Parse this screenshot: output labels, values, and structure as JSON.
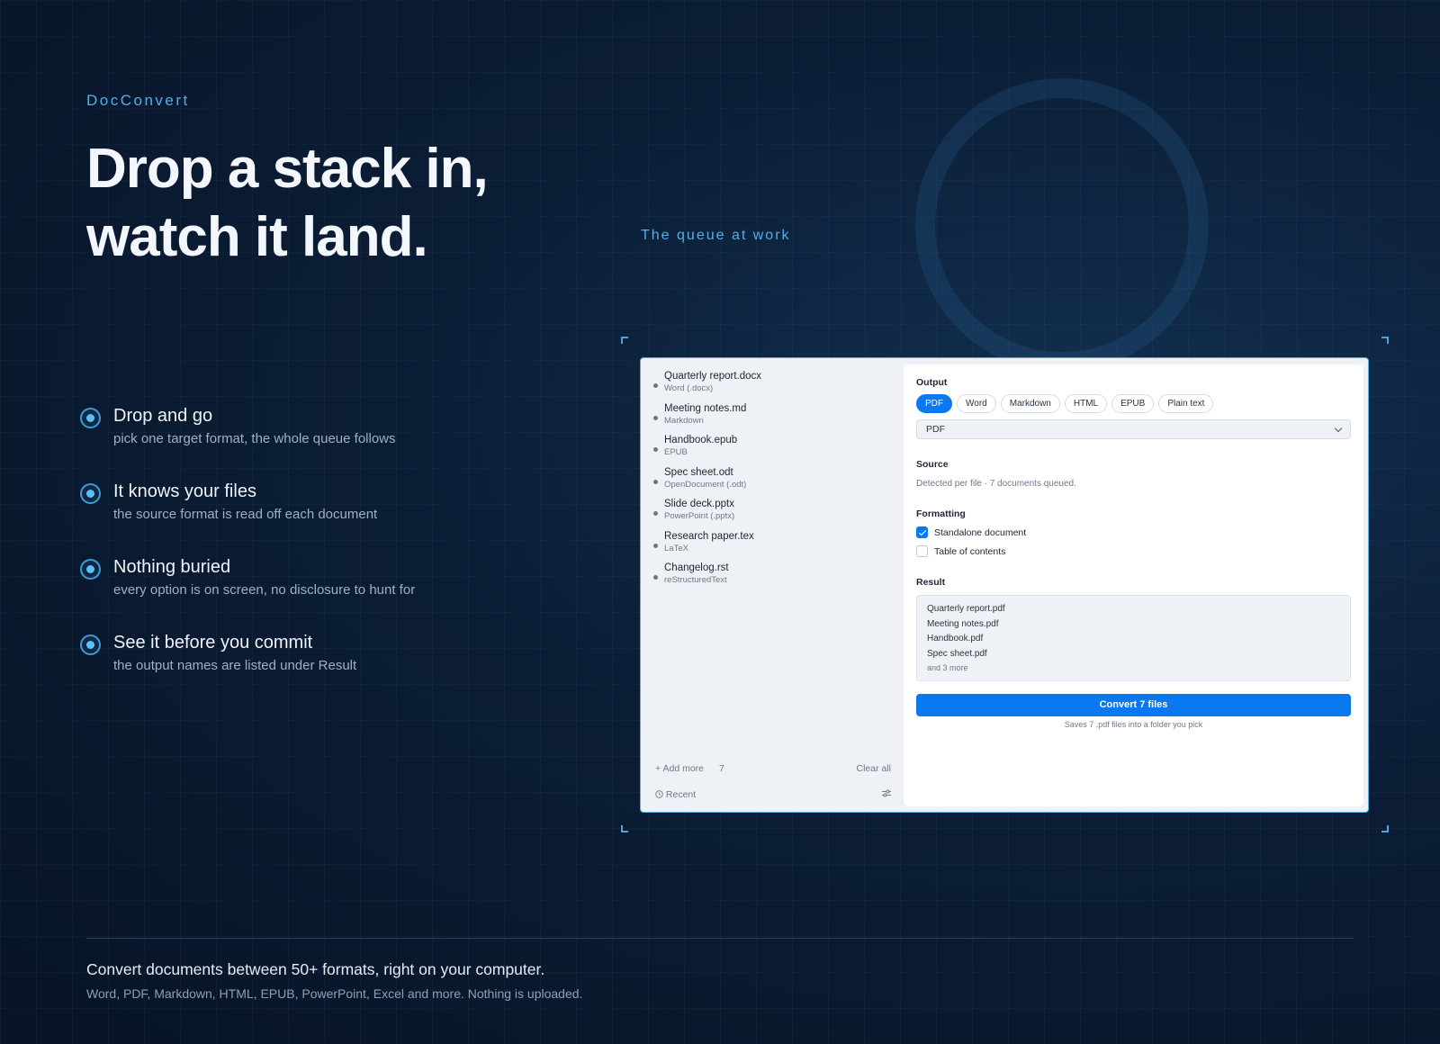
{
  "brand": "DocConvert",
  "headline": [
    "Drop a stack in,",
    "watch it land."
  ],
  "queue_label": "The queue at work",
  "features": [
    {
      "title": "Drop and go",
      "desc": "pick one target format, the whole queue follows"
    },
    {
      "title": "It knows your files",
      "desc": "the source format is read off each document"
    },
    {
      "title": "Nothing buried",
      "desc": "every option is on screen, no disclosure to hunt for"
    },
    {
      "title": "See it before you commit",
      "desc": "the output names are listed under Result"
    }
  ],
  "app": {
    "files": [
      {
        "name": "Quarterly report.docx",
        "format": "Word (.docx)"
      },
      {
        "name": "Meeting notes.md",
        "format": "Markdown"
      },
      {
        "name": "Handbook.epub",
        "format": "EPUB"
      },
      {
        "name": "Spec sheet.odt",
        "format": "OpenDocument (.odt)"
      },
      {
        "name": "Slide deck.pptx",
        "format": "PowerPoint (.pptx)"
      },
      {
        "name": "Research paper.tex",
        "format": "LaTeX"
      },
      {
        "name": "Changelog.rst",
        "format": "reStructuredText"
      }
    ],
    "sidebar_footer": {
      "add_more": "Add more",
      "count": "7",
      "clear_all": "Clear all",
      "recent": "Recent"
    },
    "output": {
      "title": "Output",
      "chips": [
        "PDF",
        "Word",
        "Markdown",
        "HTML",
        "EPUB",
        "Plain text"
      ],
      "active_chip": "PDF",
      "select_value": "PDF"
    },
    "source": {
      "title": "Source",
      "text": "Detected per file · 7 documents queued."
    },
    "formatting": {
      "title": "Formatting",
      "options": [
        {
          "label": "Standalone document",
          "checked": true
        },
        {
          "label": "Table of contents",
          "checked": false
        }
      ]
    },
    "result": {
      "title": "Result",
      "names": [
        "Quarterly report.pdf",
        "Meeting notes.pdf",
        "Handbook.pdf",
        "Spec sheet.pdf"
      ],
      "more": "and 3 more"
    },
    "convert": {
      "label": "Convert 7 files",
      "note": "Saves 7 .pdf files into a folder you pick"
    }
  },
  "footer": {
    "title": "Convert documents between 50+ formats, right on your computer.",
    "subtitle": "Word, PDF, Markdown, HTML, EPUB, PowerPoint, Excel and more. Nothing is uploaded."
  },
  "colors": {
    "accent": "#0a78f0",
    "highlight": "#4fb0e8",
    "background": "#0b1d35"
  },
  "icons": {
    "add": "plus-icon",
    "recent": "clock-icon",
    "settings": "sliders-icon",
    "select": "chevron-down-icon",
    "check": "checkmark-icon"
  }
}
